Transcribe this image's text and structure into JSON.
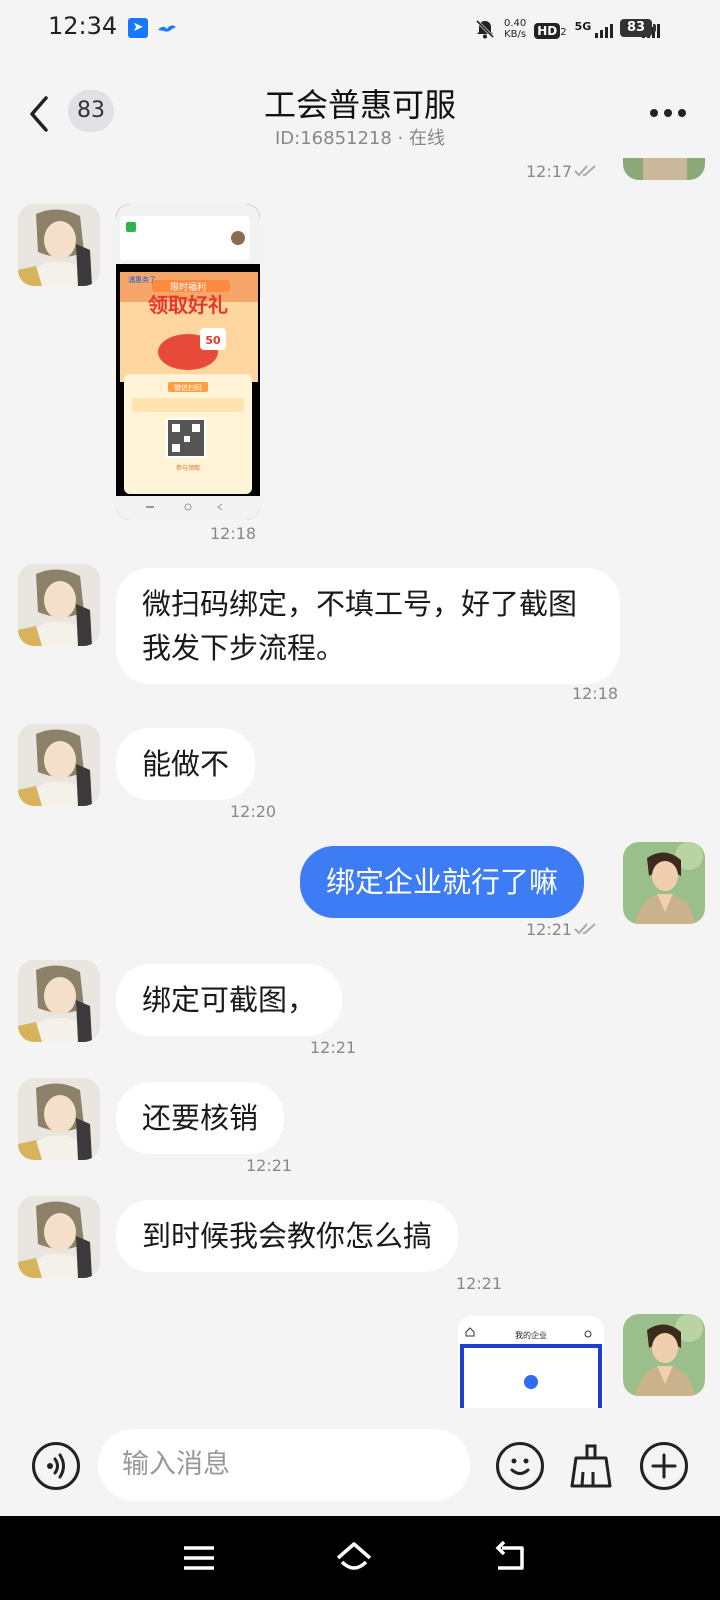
{
  "status_bar": {
    "time": "12:34",
    "app_icon_1": "signal-app-icon",
    "app_icon_2": "bird-app-icon",
    "mute_icon": "bell-off-icon",
    "net_speed_value": "0.40",
    "net_speed_unit": "KB/s",
    "hd_label": "HD",
    "hd_sub": "2",
    "sig1_label": "5G",
    "sig2_label": "5G",
    "battery": "83"
  },
  "header": {
    "unread_count": "83",
    "title": "工会普惠可服",
    "subtitle": "ID:16851218 · 在线"
  },
  "messages": [
    {
      "side": "right",
      "type": "partial",
      "time": "12:17"
    },
    {
      "side": "left",
      "type": "image",
      "time": "12:18",
      "image": {
        "brand": "浦惠务了",
        "promo_top": "限时福利",
        "promo_title": "领取好礼",
        "promo_amount": "50",
        "scan_label": "微信扫码",
        "bottom_label": "参与领取"
      }
    },
    {
      "side": "left",
      "type": "text",
      "text": "微扫码绑定，不填工号，好了截图我发下步流程。",
      "time": "12:18"
    },
    {
      "side": "left",
      "type": "text",
      "text": "能做不",
      "time": "12:20"
    },
    {
      "side": "right",
      "type": "text",
      "text": "绑定企业就行了嘛",
      "time": "12:21"
    },
    {
      "side": "left",
      "type": "text",
      "text": "绑定可截图，",
      "time": "12:21"
    },
    {
      "side": "left",
      "type": "text",
      "text": "还要核销",
      "time": "12:21"
    },
    {
      "side": "left",
      "type": "text",
      "text": "到时候我会教你怎么搞",
      "time": "12:21"
    },
    {
      "side": "right",
      "type": "image",
      "image": {
        "title": "我的企业"
      }
    }
  ],
  "input_bar": {
    "placeholder": "输入消息"
  },
  "colors": {
    "accent": "#3d7cf5",
    "background": "#f4f4f4",
    "bubble_left": "#ffffff"
  }
}
